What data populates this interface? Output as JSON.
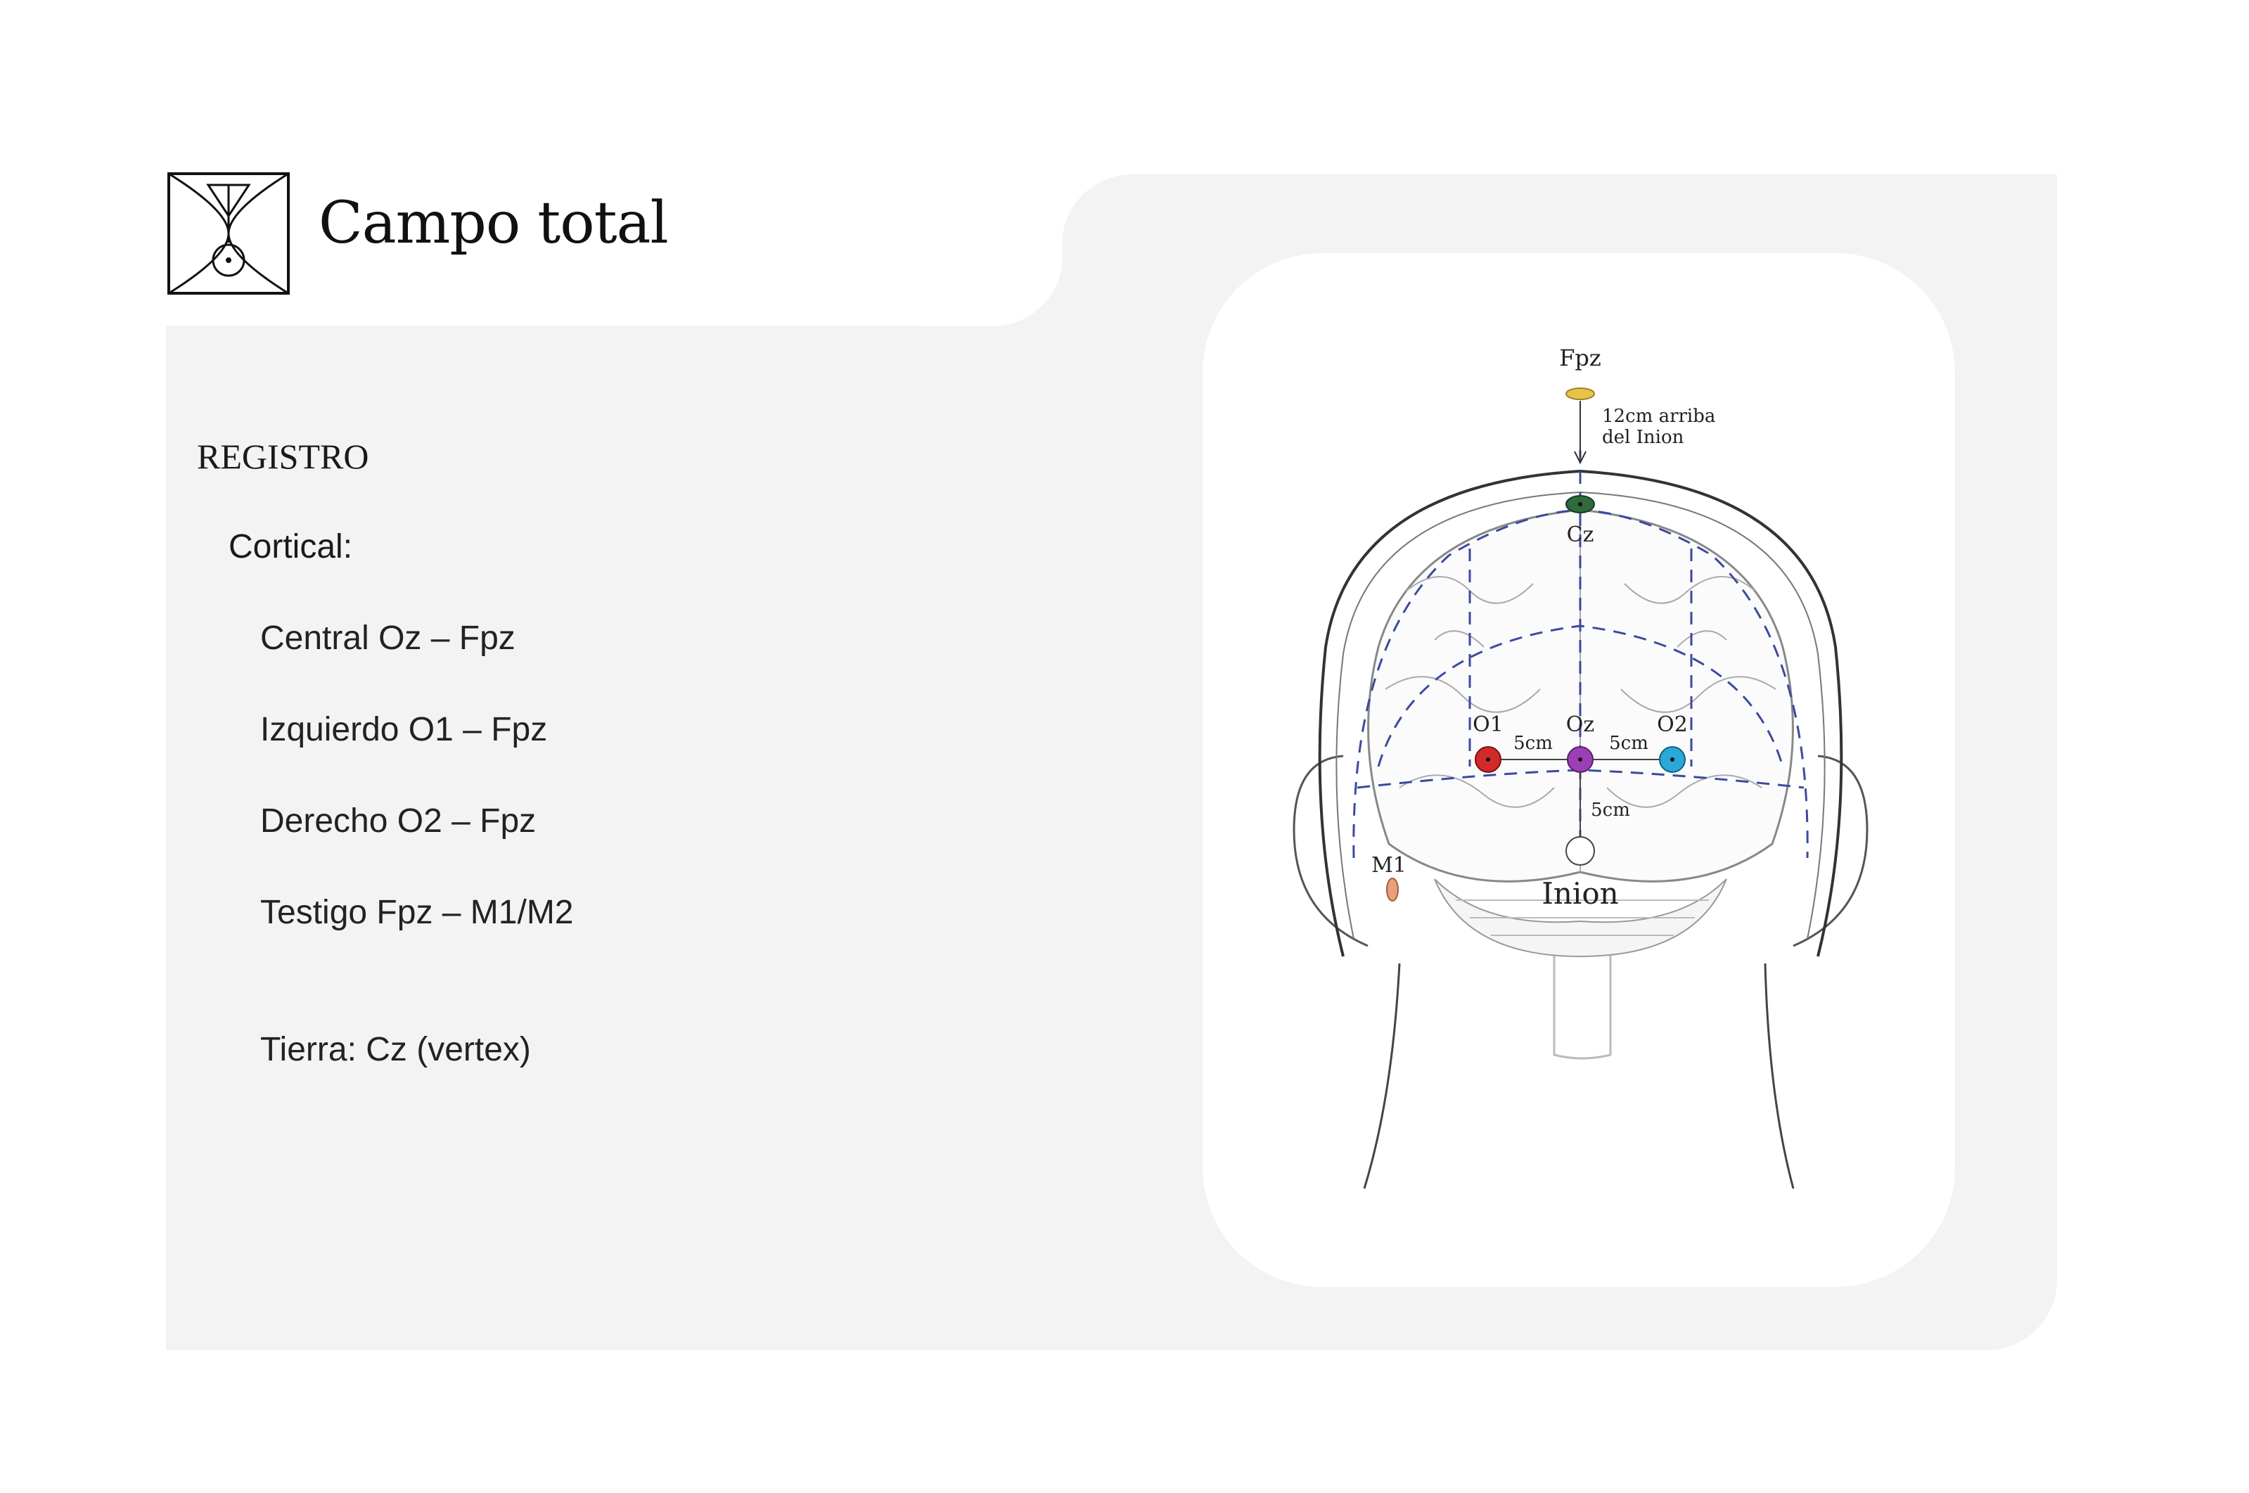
{
  "header": {
    "title": "Campo total"
  },
  "content": {
    "section": "REGISTRO",
    "subsection": "Cortical:",
    "montages": [
      "Central Oz – Fpz",
      "Izquierdo O1 – Fpz",
      "Derecho O2 – Fpz",
      "Testigo Fpz – M1/M2"
    ],
    "ground": "Tierra: Cz (vertex)"
  },
  "diagram": {
    "labels": {
      "fpz": "Fpz",
      "fpz_note_1": "12cm arriba",
      "fpz_note_2": "del Inion",
      "cz": "Cz",
      "o1": "O1",
      "oz": "Oz",
      "o2": "O2",
      "dist_left": "5cm",
      "dist_right": "5cm",
      "dist_down": "5cm",
      "m1": "M1",
      "inion": "Inion"
    },
    "colors": {
      "fpz": "#e8c34a",
      "cz": "#2f6b3d",
      "o1": "#d12a2a",
      "oz": "#9b3fb5",
      "o2": "#2aa8d8",
      "m1": "#e8a07a",
      "grid_line": "#3b4aa0"
    }
  }
}
